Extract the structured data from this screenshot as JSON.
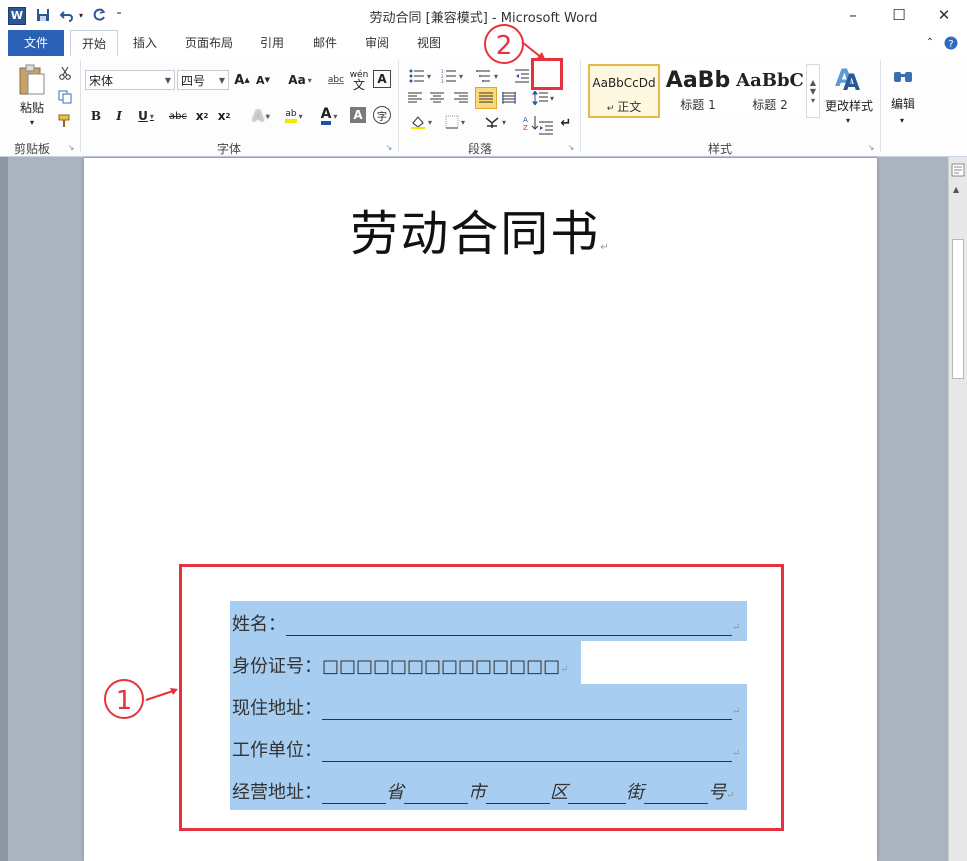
{
  "window": {
    "title": "劳动合同 [兼容模式] - Microsoft Word",
    "minimize": "–",
    "maximize": "☐",
    "close": "✕",
    "app_icon": "W"
  },
  "quick_access": {
    "save_icon": "save-icon",
    "undo_icon": "undo-icon",
    "redo_icon": "redo-icon",
    "customize_icon": "customize-icon"
  },
  "tabs": [
    {
      "label": "文件"
    },
    {
      "label": "开始"
    },
    {
      "label": "插入"
    },
    {
      "label": "页面布局"
    },
    {
      "label": "引用"
    },
    {
      "label": "邮件"
    },
    {
      "label": "审阅"
    },
    {
      "label": "视图"
    }
  ],
  "ribbon": {
    "clipboard": {
      "paste_label": "粘贴",
      "group_label": "剪贴板"
    },
    "font": {
      "font_name": "宋体",
      "font_size": "四号",
      "grow": "A",
      "shrink": "A",
      "change_case": "Aa",
      "clear_format": "abc",
      "phonetic": "wén",
      "border_char": "A",
      "bold": "B",
      "italic": "I",
      "underline": "U",
      "strikethrough": "abc",
      "subscript": "x",
      "superscript": "x",
      "text_effect": "A",
      "highlight": "ab",
      "font_color": "A",
      "char_shading": "A",
      "enclose": "字",
      "group_label": "字体"
    },
    "paragraph": {
      "group_label": "段落"
    },
    "styles": {
      "items": [
        {
          "sample": "AaBbCcDd",
          "name": "正文"
        },
        {
          "sample": "AaBb",
          "name": "标题 1"
        },
        {
          "sample": "AaBbC",
          "name": "标题 2"
        }
      ],
      "change_styles": "更改样式",
      "group_label": "样式"
    },
    "editing": {
      "label": "编辑"
    }
  },
  "document": {
    "title": "劳动合同书",
    "lines": [
      {
        "label": "姓名：",
        "suffix": ""
      },
      {
        "label": "身份证号：",
        "suffix": "□□□□□□□□□□□□□□"
      },
      {
        "label": "现住地址：",
        "suffix": ""
      },
      {
        "label": "工作单位：",
        "suffix": ""
      }
    ],
    "address_line": {
      "label": "经营地址：",
      "parts": [
        "省",
        "市",
        "区",
        "街",
        "号"
      ]
    },
    "paragraph_mark": "↵"
  },
  "annotations": {
    "marker1": "1",
    "marker2": "2"
  },
  "colors": {
    "accent_red": "#e6323e",
    "selection": "#a7cdf0",
    "file_tab": "#2a61b6"
  }
}
